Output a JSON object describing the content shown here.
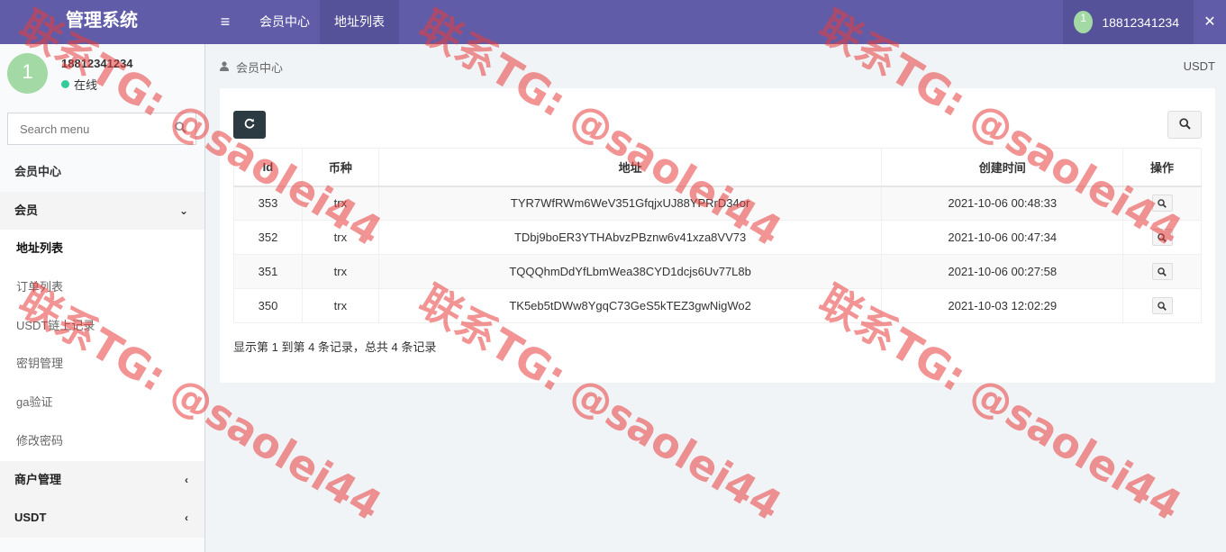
{
  "app": {
    "title": "管理系统"
  },
  "topnav": {
    "tabs": [
      {
        "label": "会员中心"
      },
      {
        "label": "地址列表"
      }
    ],
    "user": {
      "avatar": "1",
      "name": "18812341234"
    }
  },
  "sidebar": {
    "user": {
      "avatar": "1",
      "name": "18812341234",
      "status": "在线"
    },
    "search_placeholder": "Search menu",
    "items": [
      {
        "label": "会员中心"
      },
      {
        "label": "会员"
      },
      {
        "label": "地址列表"
      },
      {
        "label": "订单列表"
      },
      {
        "label": "USDT链上记录"
      },
      {
        "label": "密钥管理"
      },
      {
        "label": "ga验证"
      },
      {
        "label": "修改密码"
      },
      {
        "label": "商户管理"
      },
      {
        "label": "USDT"
      }
    ]
  },
  "content": {
    "breadcrumb": "会员中心",
    "right_label": "USDT",
    "table": {
      "columns": [
        "Id",
        "币种",
        "地址",
        "创建时间",
        "操作"
      ],
      "rows": [
        {
          "id": "353",
          "coin": "trx",
          "address": "TYR7WfRWm6WeV351GfqjxUJ88YPRrD34or",
          "created": "2021-10-06 00:48:33"
        },
        {
          "id": "352",
          "coin": "trx",
          "address": "TDbj9boER3YTHAbvzPBznw6v41xza8VV73",
          "created": "2021-10-06 00:47:34"
        },
        {
          "id": "351",
          "coin": "trx",
          "address": "TQQQhmDdYfLbmWea38CYD1dcjs6Uv77L8b",
          "created": "2021-10-06 00:27:58"
        },
        {
          "id": "350",
          "coin": "trx",
          "address": "TK5eb5tDWw8YgqC73GeS5kTEZ3gwNigWo2",
          "created": "2021-10-03 12:02:29"
        }
      ]
    },
    "pagination": "显示第 1 到第 4 条记录，总共 4 条记录"
  },
  "watermark": {
    "text": "联系TG: @saolei44"
  },
  "colors": {
    "header": "#605ca8",
    "header_active": "#555299",
    "status_online": "#33cc99",
    "watermark": "#e83c3c"
  },
  "icons": [
    "menu-icon",
    "expand-icon",
    "search-icon",
    "refresh-icon",
    "user-icon",
    "chevron-down-icon",
    "chevron-left-icon"
  ]
}
